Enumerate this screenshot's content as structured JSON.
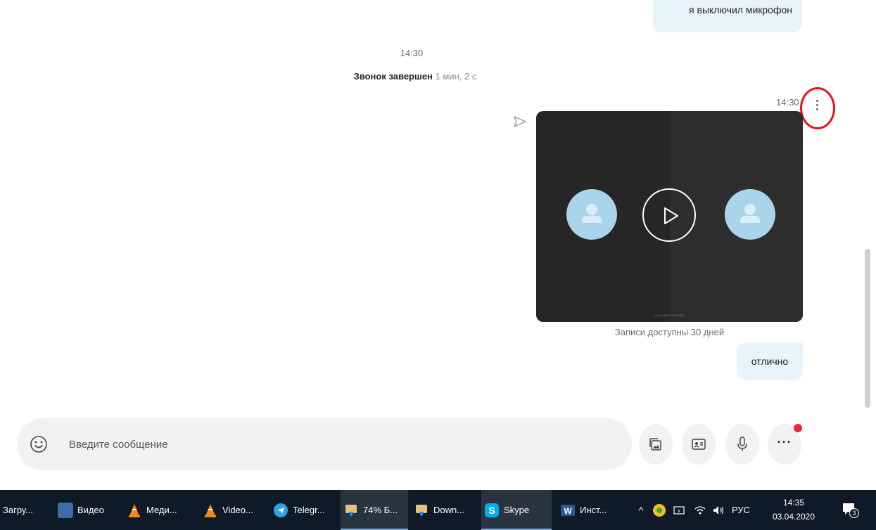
{
  "chat": {
    "top_message": "я выключил микрофон",
    "call_timestamp": "14:30",
    "call_ended_label": "Звонок завершен",
    "call_duration": "1 мин, 2 с",
    "video_message_time": "14:30",
    "recording_caption": "Записи доступны 30 дней",
    "recording_id": "5e4c0d8b8e73a5b2982",
    "last_message": "отлично"
  },
  "composer": {
    "placeholder": "Введите сообщение",
    "more_button": "···"
  },
  "taskbar": {
    "items": [
      {
        "label": "Загру...",
        "color": "#f0c24b"
      },
      {
        "label": "Видео",
        "color": "#3a6ea5"
      },
      {
        "label": "Меди...",
        "color": "#f08a1c"
      },
      {
        "label": "Video...",
        "color": "#f08a1c"
      },
      {
        "label": "Telegr...",
        "color": "#2fa3e0"
      },
      {
        "label": "74% Б...",
        "color": "#6cba4a"
      },
      {
        "label": "Down...",
        "color": "#6cba4a"
      },
      {
        "label": "Skype",
        "color": "#00aff0"
      },
      {
        "label": "Инст...",
        "color": "#2b579a"
      }
    ],
    "tray": {
      "chevron": "^",
      "language": "РУС",
      "time": "14:35",
      "date": "03.04.2020",
      "notification_count": "3"
    }
  },
  "colors": {
    "bubble": "#e8f4fb",
    "taskbar": "#0f1a28",
    "highlight_circle": "#e8101c",
    "notification_dot": "#e8283a"
  }
}
